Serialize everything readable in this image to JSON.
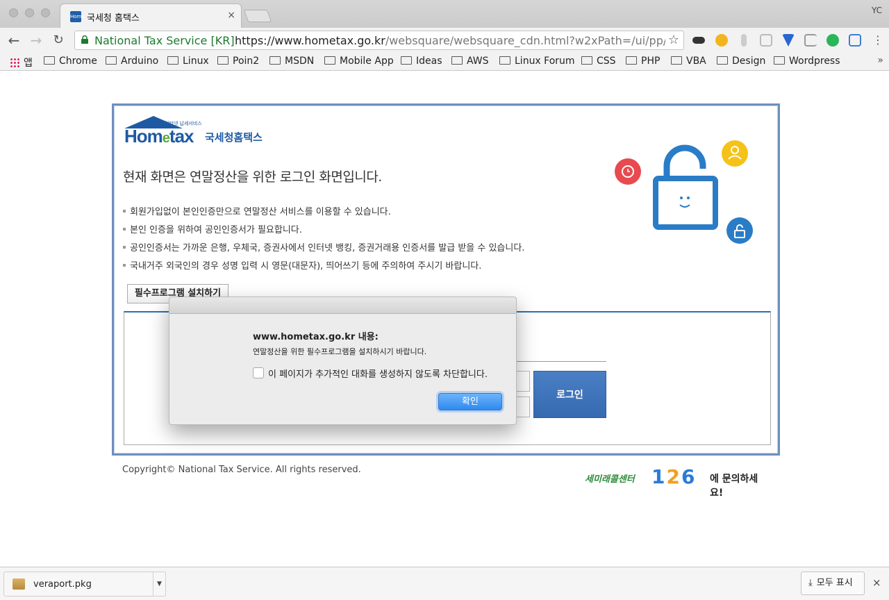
{
  "browser": {
    "tab_title": "국세청 홈택스",
    "tab_close": "×",
    "profile": "YC",
    "site_name": "National Tax Service [KR]",
    "url_host": "https://www.hometax.go.kr",
    "url_path": "/websquare/websquare_cdn.html?w2xPath=/ui/pp/UUY...",
    "bookmarks": [
      "앱",
      "Chrome",
      "Arduino",
      "Linux",
      "Poin2",
      "MSDN",
      "Mobile App",
      "Ideas",
      "AWS",
      "Linux Forum",
      "CSS",
      "PHP",
      "VBA",
      "Design",
      "Wordpress"
    ],
    "bookmarks_more": "»"
  },
  "page": {
    "logo_small": "인터넷 납세서비스",
    "logo_text_pre": "Hom",
    "logo_text_e": "e",
    "logo_text_post": "tax",
    "logo_kr": "국세청홈택스",
    "headline": "현재 화면은 연말정산을 위한 로그인 화면입니다.",
    "bullets": [
      "회원가입없이 본인인증만으로 연말정산 서비스를 이용할 수 있습니다.",
      "본인 인증을 위하여 공인인증서가 필요합니다.",
      "공인인증서는 가까운 은행, 우체국, 증권사에서 인터넷 뱅킹, 증권거래용 인증서를 발급 받을 수 있습니다.",
      "국내거주 외국인의 경우 성명 입력 시 영문(대문자), 띄어쓰기 등에 주의하여 주시기 바랍니다."
    ],
    "install_button": "필수프로그램 설치하기",
    "login_button": "로그인",
    "copyright": "Copyright© National Tax Service. All rights reserved.",
    "callcenter_prefix": "세미래콜센터",
    "callcenter_num_1": "1",
    "callcenter_num_2": "2",
    "callcenter_num_3": "6",
    "callcenter_suffix": "에 문의하세요!"
  },
  "dialog": {
    "title": "www.hometax.go.kr 내용:",
    "message": "연말정산을 위한 필수프로그램을 설치하시기 바랍니다.",
    "checkbox_label": "이 페이지가 추가적인 대화를 생성하지 않도록 차단합니다.",
    "ok_button": "확인"
  },
  "downloads": {
    "file_name": "veraport.pkg",
    "show_all": "모두 표시",
    "close": "×"
  },
  "colors": {
    "accent": "#2f8af0",
    "brand_blue": "#1e5aa3",
    "frame_border": "#6f8fbf"
  }
}
